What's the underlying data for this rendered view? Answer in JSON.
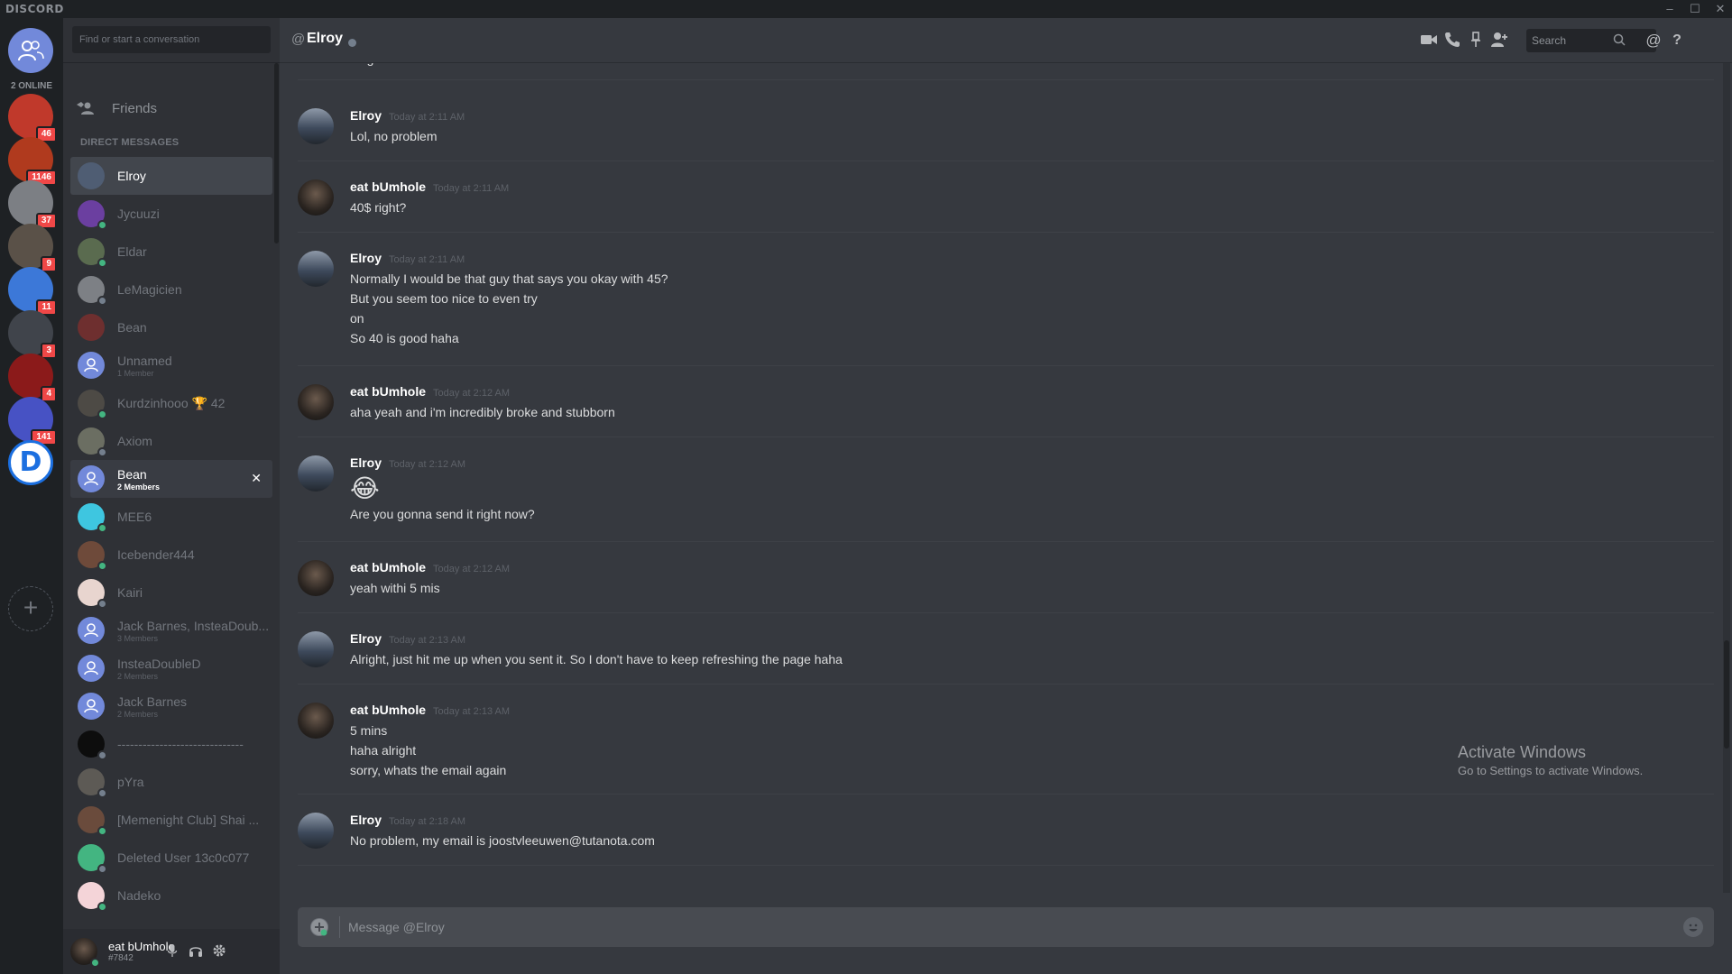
{
  "app": {
    "brand": "DISCORD",
    "window_controls": [
      "–",
      "☐",
      "✕"
    ]
  },
  "rail": {
    "online_count": "2 ONLINE",
    "servers": [
      {
        "name": "say-no-to-soy",
        "badge": "46",
        "color": "#c0392b"
      },
      {
        "name": "red-emblem",
        "badge": "1146",
        "color": "#b03a1e"
      },
      {
        "name": "picture-server",
        "badge": "37",
        "color": "#7c7f84"
      },
      {
        "name": "character-server",
        "badge": "9",
        "color": "#5a5148"
      },
      {
        "name": "sneaker-server",
        "badge": "11",
        "color": "#3c78d8"
      },
      {
        "name": "gray-server",
        "badge": "3",
        "color": "#40444b"
      },
      {
        "name": "red-logo-server",
        "badge": "4",
        "color": "#8b1a1a"
      },
      {
        "name": "wave-server",
        "badge": "141",
        "color": "#4752c4"
      },
      {
        "name": "d-server",
        "badge": "",
        "color": "#ffffff"
      }
    ],
    "add_label": "+"
  },
  "dm": {
    "search_placeholder": "Find or start a conversation",
    "friends_label": "Friends",
    "header": "DIRECT MESSAGES",
    "items": [
      {
        "name": "Elroy",
        "sub": "",
        "state": "active",
        "avatar": "#4f5d73",
        "status": ""
      },
      {
        "name": "Jycuuzi",
        "sub": "",
        "state": "",
        "avatar": "#6b3fa0",
        "status": "#43b581"
      },
      {
        "name": "Eldar",
        "sub": "",
        "state": "",
        "avatar": "#5a6b4f",
        "status": "#43b581"
      },
      {
        "name": "LeMagicien",
        "sub": "",
        "state": "",
        "avatar": "#7d8085",
        "status": "#747f8d"
      },
      {
        "name": "Bean",
        "sub": "",
        "state": "",
        "avatar": "#6e2f2f",
        "status": ""
      },
      {
        "name": "Unnamed",
        "sub": "1 Member",
        "state": "",
        "avatar": "#7289da",
        "status": ""
      },
      {
        "name": "Kurdzinhooo 🏆 42",
        "sub": "",
        "state": "",
        "avatar": "#4d4a45",
        "status": "#43b581"
      },
      {
        "name": "Axiom",
        "sub": "",
        "state": "",
        "avatar": "#6b6e62",
        "status": "#747f8d"
      },
      {
        "name": "Bean",
        "sub": "2 Members",
        "state": "hover",
        "avatar": "#7289da",
        "status": ""
      },
      {
        "name": "MEE6",
        "sub": "",
        "state": "",
        "avatar": "#3ec6e0",
        "status": "#43b581"
      },
      {
        "name": "Icebender444",
        "sub": "",
        "state": "",
        "avatar": "#6e4a3a",
        "status": "#43b581"
      },
      {
        "name": "Kairi",
        "sub": "",
        "state": "",
        "avatar": "#e8d5cf",
        "status": "#747f8d"
      },
      {
        "name": "Jack Barnes, InsteaDoub...",
        "sub": "3 Members",
        "state": "",
        "avatar": "#7289da",
        "status": ""
      },
      {
        "name": "InsteaDoubleD",
        "sub": "2 Members",
        "state": "",
        "avatar": "#7289da",
        "status": ""
      },
      {
        "name": "Jack Barnes",
        "sub": "2 Members",
        "state": "",
        "avatar": "#7289da",
        "status": ""
      },
      {
        "name": "------------------------------",
        "sub": "",
        "state": "",
        "avatar": "#0d0d0d",
        "status": "#747f8d"
      },
      {
        "name": "pYra",
        "sub": "",
        "state": "",
        "avatar": "#5d5a55",
        "status": "#747f8d"
      },
      {
        "name": "[Memenight Club] Shai ...",
        "sub": "",
        "state": "",
        "avatar": "#6a4b3c",
        "status": "#43b581"
      },
      {
        "name": "Deleted User 13c0c077",
        "sub": "",
        "state": "",
        "avatar": "#43b581",
        "status": "#747f8d"
      },
      {
        "name": "Nadeko",
        "sub": "",
        "state": "",
        "avatar": "#f4d4d8",
        "status": "#43b581"
      }
    ],
    "close_icon": "✕",
    "user": {
      "name": "eat bUmhole",
      "tag": "#7842"
    }
  },
  "chat": {
    "title": "Elroy",
    "search_placeholder": "Search",
    "composer_placeholder": "Message @Elroy",
    "messages": [
      {
        "author": "",
        "time": "",
        "lines": [
          "alright"
        ]
      },
      {
        "author": "Elroy",
        "time": "Today at 2:11 AM",
        "lines": [
          "Lol, no problem"
        ]
      },
      {
        "author": "eat bUmhole",
        "time": "Today at 2:11 AM",
        "lines": [
          "40$ right?"
        ]
      },
      {
        "author": "Elroy",
        "time": "Today at 2:11 AM",
        "lines": [
          "Normally I would be that guy that says you okay with 45?",
          "But you seem too nice to even try",
          "on",
          "So 40 is good haha"
        ]
      },
      {
        "author": "eat bUmhole",
        "time": "Today at 2:12 AM",
        "lines": [
          "aha yeah and i'm incredibly broke and stubborn"
        ]
      },
      {
        "author": "Elroy",
        "time": "Today at 2:12 AM",
        "emoji": "😂",
        "lines": [
          "Are you gonna send it right now?"
        ]
      },
      {
        "author": "eat bUmhole",
        "time": "Today at 2:12 AM",
        "lines": [
          "yeah withi 5 mis"
        ]
      },
      {
        "author": "Elroy",
        "time": "Today at 2:13 AM",
        "lines": [
          "Alright, just hit me up when you sent it. So I don't have to keep refreshing the page haha"
        ]
      },
      {
        "author": "eat bUmhole",
        "time": "Today at 2:13 AM",
        "lines": [
          "5 mins",
          "haha alright",
          "sorry, whats the email again"
        ]
      },
      {
        "author": "Elroy",
        "time": "Today at 2:18 AM",
        "lines": [
          "No problem, my email is joostvleeuwen@tutanota.com"
        ]
      }
    ]
  },
  "watermark": {
    "line1": "Activate Windows",
    "line2": "Go to Settings to activate Windows."
  },
  "colors": {
    "blurple": "#7289da",
    "online": "#43b581",
    "badge": "#f04747"
  }
}
